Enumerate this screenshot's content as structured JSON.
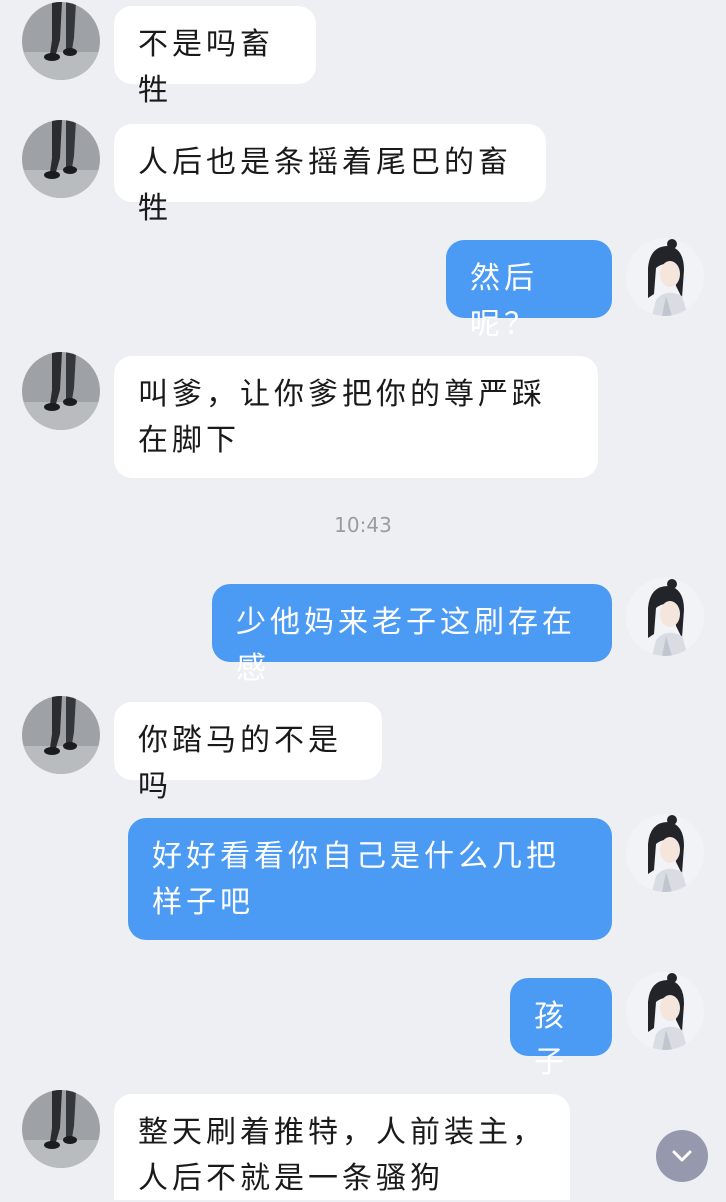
{
  "conversation": {
    "messages": [
      {
        "side": "in",
        "text": "不是吗畜牲"
      },
      {
        "side": "in",
        "text": "人后也是条摇着尾巴的畜牲"
      },
      {
        "side": "out",
        "text": "然后呢？"
      },
      {
        "side": "in",
        "text": "叫爹，让你爹把你的尊严踩在脚下"
      },
      {
        "side": "out",
        "text": "少他妈来老子这刷存在感"
      },
      {
        "side": "in",
        "text": "你踏马的不是吗"
      },
      {
        "side": "out",
        "text": "好好看看你自己是什么几把样子吧"
      },
      {
        "side": "out",
        "text": "孩子"
      },
      {
        "side": "in",
        "text": "整天刷着推特，人前装主，人后不就是一条骚狗"
      }
    ],
    "timestamp": "10:43"
  },
  "avatars": {
    "incoming": "walking-legs-photo-avatar",
    "outgoing": "anime-character-avatar"
  },
  "controls": {
    "scroll_down_icon": "chevron-down-icon"
  },
  "colors": {
    "background": "#eeeff3",
    "incoming_bubble": "#ffffff",
    "outgoing_bubble": "#4b9bf5",
    "timestamp_text": "#9a9ca3"
  }
}
